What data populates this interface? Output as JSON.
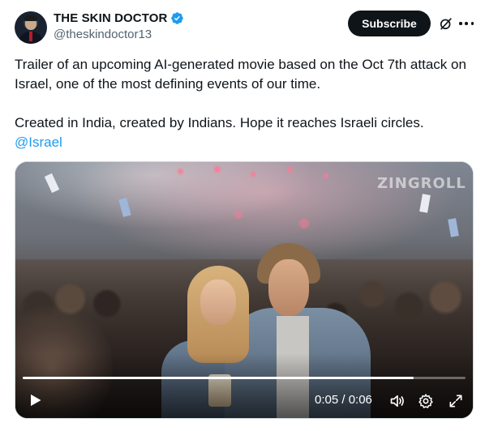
{
  "author": {
    "display_name": "THE SKIN DOCTOR",
    "handle": "@theskindoctor13",
    "verified_icon": "verified-badge-icon",
    "verified_color": "#1d9bf0"
  },
  "header_actions": {
    "subscribe_label": "Subscribe",
    "grok_icon": "grok-icon",
    "more_icon": "more-options-icon"
  },
  "tweet": {
    "line1": "Trailer of an upcoming AI-generated movie based on the Oct 7th attack on Israel, one of the most defining events of our time.",
    "line2": "Created in India, created by Indians. Hope it reaches Israeli circles.",
    "mention": "@Israel"
  },
  "video": {
    "watermark": "ZINGROLL",
    "time": "0:05 / 0:06",
    "progress": 0.883,
    "play_icon": "play-icon",
    "volume_icon": "volume-icon",
    "settings_icon": "settings-gear-icon",
    "fullscreen_icon": "fullscreen-icon"
  },
  "colors": {
    "text": "#0f1419",
    "secondary": "#536471",
    "link": "#1d9bf0",
    "button_bg": "#0f1419"
  }
}
